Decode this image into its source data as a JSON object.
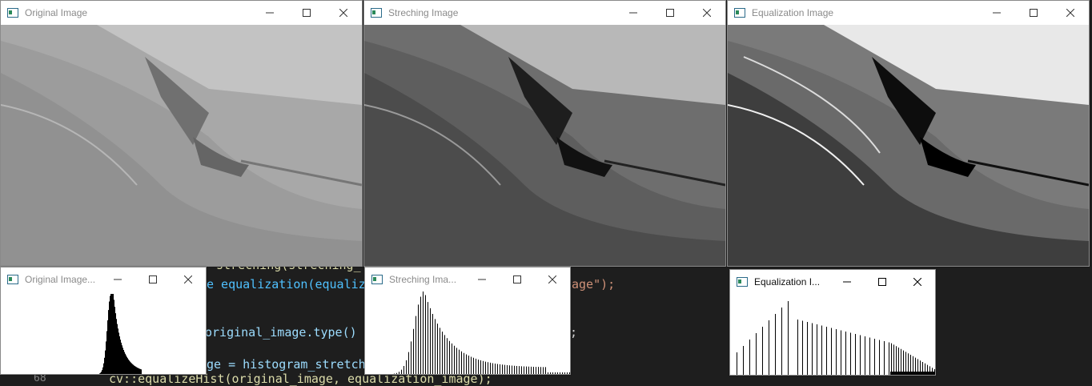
{
  "editor": {
    "line_number": "68",
    "lines": [
      {
        "a": "streching(streching_",
        "b": "",
        "c": ""
      },
      {
        "a": "e equalization(equaliza",
        "b": "age\");",
        "c": ""
      },
      {
        "a": "original_image.type() ",
        "b": ";",
        "c": ""
      },
      {
        "a": "ge = histogram_stretch",
        "b": "",
        "c": ""
      },
      {
        "a": "cv::equalizeHist(original_image, equalization_image);",
        "b": "",
        "c": ""
      }
    ]
  },
  "windows": {
    "original_image": {
      "title": "Original Image"
    },
    "streching_image": {
      "title": "Streching Image"
    },
    "equalization_image": {
      "title": "Equalization Image"
    },
    "original_hist": {
      "title": "Original Image..."
    },
    "streching_hist": {
      "title": "Streching Ima..."
    },
    "equalization_hist": {
      "title": "Equalization I..."
    }
  },
  "icons": {
    "app": "window-app-icon",
    "minimize": "minimize-icon",
    "maximize": "maximize-icon",
    "close": "close-icon"
  }
}
